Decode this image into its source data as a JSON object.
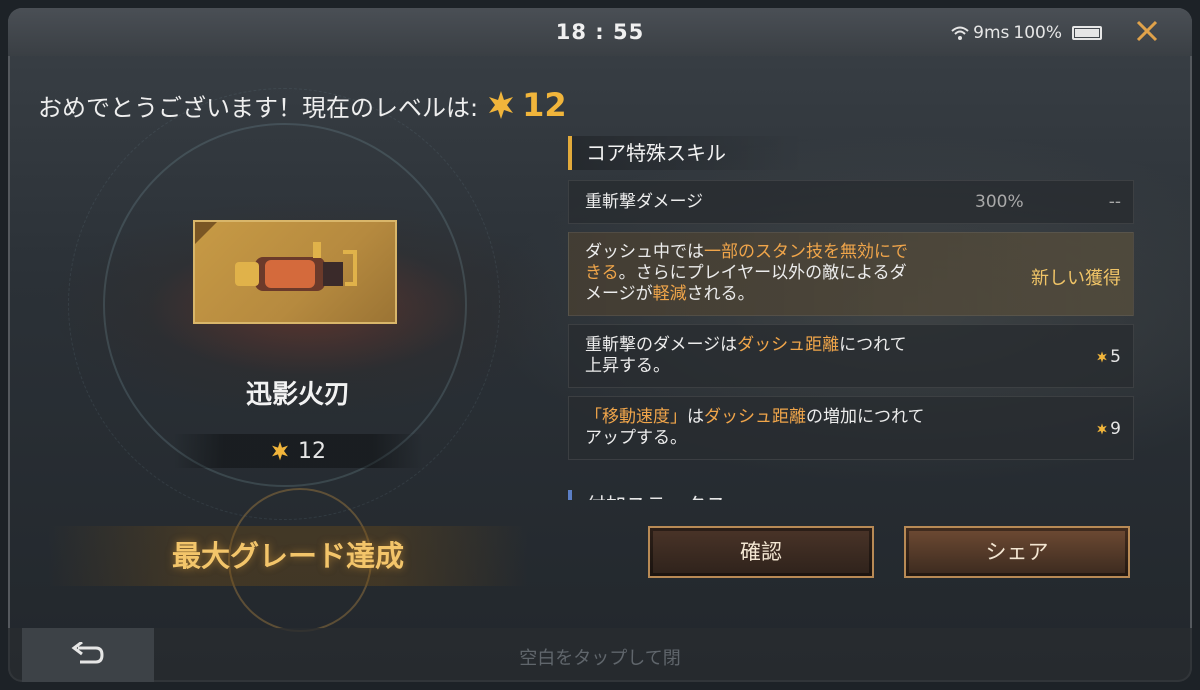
{
  "status": {
    "time": "18 : 55",
    "ping": "9ms",
    "battery": "100%"
  },
  "header": {
    "congrats_text": "おめでとうございます！現在のレベルは:",
    "level": "12"
  },
  "weapon": {
    "name": "迅影火刃",
    "level": "12",
    "max_grade_text": "最大グレード達成"
  },
  "skills": {
    "section_title": "コア特殊スキル",
    "rows": [
      {
        "text": "重斬撃ダメージ",
        "value": "300%",
        "right": "--"
      },
      {
        "line1_a": "ダッシュ中では",
        "line1_hl": "一部のスタン技を無効にで",
        "line2_hl": "きる",
        "line2_b": "。さらにプレイヤー以外の敵によるダ",
        "line3_a": "メージが",
        "line3_hl": "軽減",
        "line3_b": "される。",
        "right": "新しい獲得"
      },
      {
        "line1_a": "重斬撃のダメージは",
        "line1_hl": "ダッシュ距離",
        "line1_b": "につれて",
        "line2_a": "上昇する。",
        "right": "5"
      },
      {
        "line1_hl": "「移動速度」",
        "line1_a": "は",
        "line1_hl2": "ダッシュ距離",
        "line1_b": "の増加につれて",
        "line2_a": "アップする。",
        "right": "9"
      }
    ],
    "next_section_title": "付加ステータス"
  },
  "buttons": {
    "confirm": "確認",
    "share": "シェア"
  },
  "footer": {
    "hint": "空白をタップして閉"
  },
  "colors": {
    "accent_gold": "#f1b53b",
    "highlight": "#f0a54a",
    "button_border": "#b88a55"
  },
  "icons": [
    "wifi-icon",
    "battery-icon",
    "close-icon",
    "star-icon",
    "back-arrow-icon",
    "weapon-image"
  ]
}
